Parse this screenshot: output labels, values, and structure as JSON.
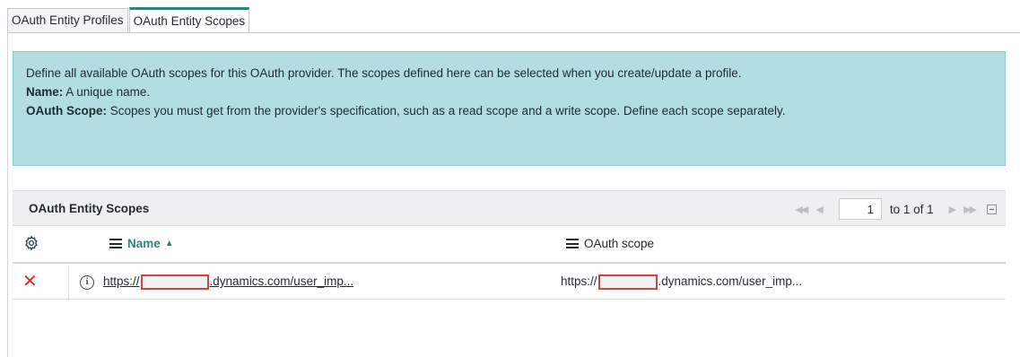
{
  "tabs": [
    {
      "label": "OAuth Entity Profiles",
      "active": false
    },
    {
      "label": "OAuth Entity Scopes",
      "active": true
    }
  ],
  "info": {
    "line1": "Define all available OAuth scopes for this OAuth provider. The scopes defined here can be selected when you create/update a profile.",
    "name_label": "Name:",
    "name_text": " A unique name.",
    "scope_label": "OAuth Scope:",
    "scope_text": " Scopes you must get from the provider's specification, such as a read scope and a write scope. Define each scope separately."
  },
  "list": {
    "title": "OAuth Entity Scopes",
    "page_value": "1",
    "page_text": "to 1 of 1",
    "columns": {
      "name": "Name",
      "scope": "OAuth scope"
    },
    "rows": [
      {
        "name_prefix": "https://",
        "name_suffix": ".dynamics.com/user_imp...",
        "scope_prefix": "https://",
        "scope_suffix": ".dynamics.com/user_imp..."
      }
    ]
  },
  "icons": {
    "first": "first-page-icon",
    "prev": "previous-page-icon",
    "next": "next-page-icon",
    "last": "last-page-icon",
    "collapse": "collapse-icon",
    "settings": "gear-icon",
    "delete": "delete-icon",
    "info": "info-icon",
    "menu": "menu-icon",
    "sort": "sort-ascending-icon"
  },
  "colors": {
    "accent": "#2c8576",
    "info_bg": "#b2dde1",
    "delete": "#d93025",
    "redaction": "#e23b3b"
  }
}
